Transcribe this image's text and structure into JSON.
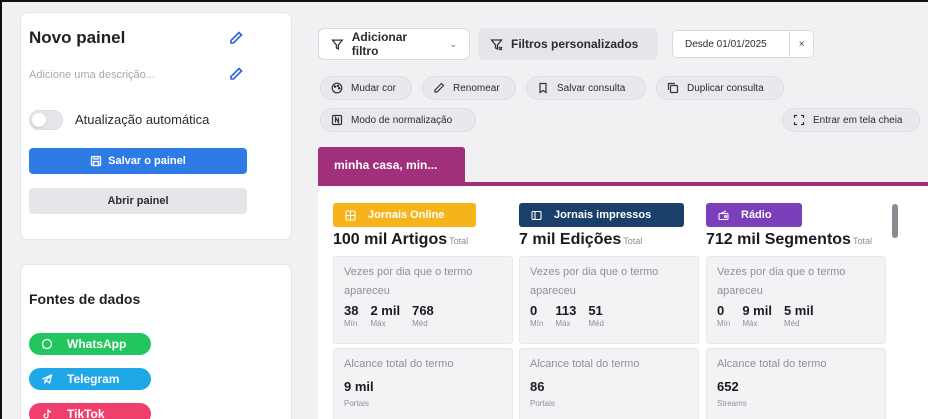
{
  "panel": {
    "title": "Novo painel",
    "description_placeholder": "Adicione uma descrição...",
    "auto_update_label": "Atualização automática",
    "auto_update_on": false,
    "save_label": "Salvar o painel",
    "open_label": "Abrir painel"
  },
  "sources": {
    "title": "Fontes de dados",
    "items": [
      {
        "label": "WhatsApp",
        "color": "#22c55e",
        "icon": "whatsapp-icon"
      },
      {
        "label": "Telegram",
        "color": "#1ea8e8",
        "icon": "telegram-icon"
      },
      {
        "label": "TikTok",
        "color": "#ef3f6c",
        "icon": "tiktok-icon"
      }
    ]
  },
  "toolbar": {
    "add_filter_label": "Adicionar filtro",
    "custom_filters_label": "Filtros personalizados",
    "date_label": "Desde 01/01/2025",
    "date_clear": "×",
    "change_color": "Mudar cor",
    "rename": "Renomear",
    "save_query": "Salvar consulta",
    "duplicate_query": "Duplicar consulta",
    "normalization": "Modo de normalização",
    "fullscreen": "Entrar em tela cheia"
  },
  "tab": {
    "label": "minha casa, min...",
    "color": "#a0307c"
  },
  "columns": [
    {
      "badge": "Jornais Online",
      "color": "#f7b31a",
      "icon": "globe-icon",
      "metric_value": "100 mil Artigos",
      "metric_sub": "Total",
      "per_day_label": "Vezes por dia que o termo apareceu",
      "min": "38",
      "max": "2 mil",
      "avg": "768",
      "min_label": "Mín",
      "max_label": "Máx",
      "avg_label": "Méd",
      "reach_label": "Alcance total do termo",
      "reach_value": "9 mil",
      "reach_unit": "Portais"
    },
    {
      "badge": "Jornais impressos",
      "color": "#193f6a",
      "icon": "newspaper-icon",
      "metric_value": "7 mil Edições",
      "metric_sub": "Total",
      "per_day_label": "Vezes por dia que o termo apareceu",
      "min": "0",
      "max": "113",
      "avg": "51",
      "min_label": "Mín",
      "max_label": "Máx",
      "avg_label": "Méd",
      "reach_label": "Alcance total do termo",
      "reach_value": "86",
      "reach_unit": "Portais"
    },
    {
      "badge": "Rádio",
      "color": "#7b3fbb",
      "icon": "radio-icon",
      "metric_value": "712 mil Segmentos",
      "metric_sub": "Total",
      "per_day_label": "Vezes por dia que o termo apareceu",
      "min": "0",
      "max": "9 mil",
      "avg": "5 mil",
      "min_label": "Mín",
      "max_label": "Máx",
      "avg_label": "Méd",
      "reach_label": "Alcance total do termo",
      "reach_value": "652",
      "reach_unit": "Streams"
    }
  ]
}
